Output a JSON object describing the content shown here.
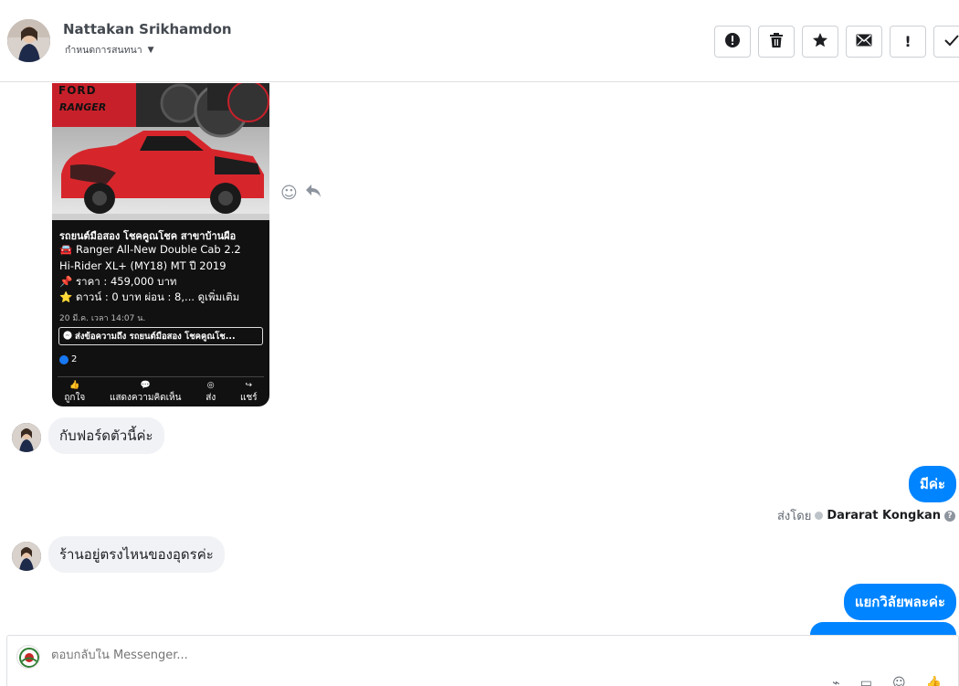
{
  "header": {
    "contact_name": "Nattakan Srikhamdon",
    "subtitle": "กำหนดการสนทนา",
    "actions": [
      {
        "name": "report-spam-button",
        "icon": "alert-circle-icon",
        "glyph": "❗"
      },
      {
        "name": "delete-button",
        "icon": "trash-icon",
        "glyph": "🗑"
      },
      {
        "name": "star-button",
        "icon": "star-icon",
        "glyph": "★"
      },
      {
        "name": "mark-unread-button",
        "icon": "envelope-icon",
        "glyph": "✉"
      },
      {
        "name": "follow-up-button",
        "icon": "exclamation-icon",
        "glyph": "!"
      },
      {
        "name": "mark-done-button",
        "icon": "check-icon",
        "glyph": "✓"
      }
    ]
  },
  "shared_post": {
    "title": "รถยนต์มือสอง โชคคูณโชค สาขาบ้านผือ",
    "line1": "🚘 Ranger All-New Double Cab 2.2",
    "line2": "Hi-Rider XL+ (MY18) MT ปี 2019",
    "line3": "📌 ราคา : 459,000 บาท",
    "line4": "⭐ ดาวน์ : 0 บาท ผ่อน : 8,... ดูเพิ่มเติม",
    "date": "20 มี.ค. เวลา 14:07 น.",
    "send_button": "ส่งข้อความถึง รถยนต์มือสอง โชคคูณโช...",
    "reaction_count": "2",
    "actions": {
      "like": "ถูกใจ",
      "comment": "แสดงความคิดเห็น",
      "send": "ส่ง",
      "share": "แชร์"
    },
    "image_text": {
      "brand": "FORD",
      "model": "RANGER"
    }
  },
  "messages": {
    "in1": "กับฟอร์ดตัวนี้ค่ะ",
    "out1": "มีค่ะ",
    "sent_by_prefix": "ส่งโดย",
    "sent_by_name": "Dararat Kongkan",
    "in2": "ร้านอยู่ตรงไหนของอุดรค่ะ",
    "out2": "แยกวิลัยพละค่ะ"
  },
  "composer": {
    "placeholder": "ตอบกลับใน Messenger..."
  },
  "colors": {
    "outgoing_bubble": "#0084ff",
    "incoming_bubble": "#f0f2f5",
    "car_red": "#d6262c"
  }
}
